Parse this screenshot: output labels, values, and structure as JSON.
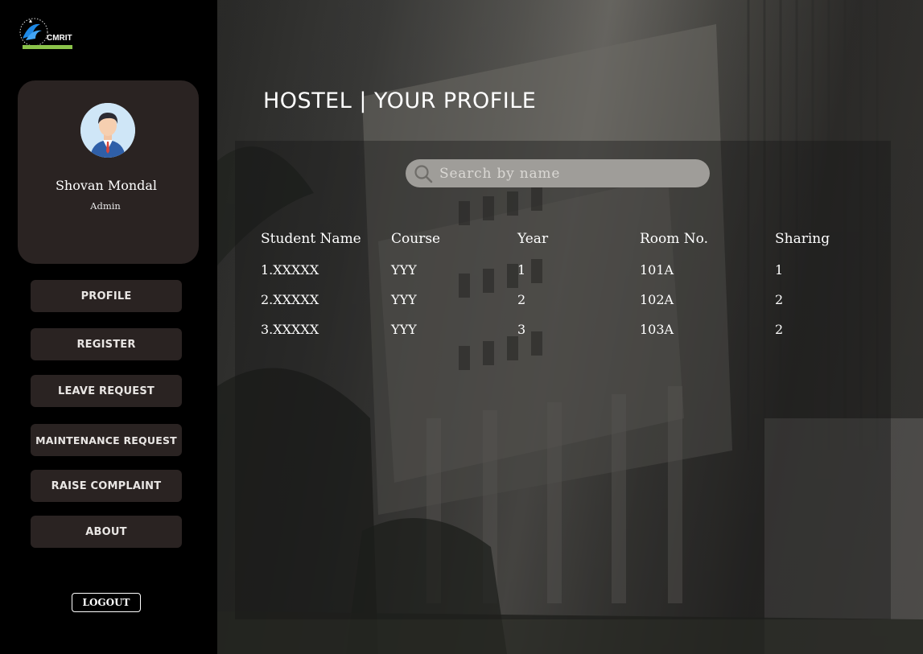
{
  "logo": {
    "text": "CMRIT"
  },
  "profile": {
    "name": "Shovan Mondal",
    "role": "Admin"
  },
  "nav": [
    {
      "label": "PROFILE"
    },
    {
      "label": "REGISTER"
    },
    {
      "label": "LEAVE REQUEST"
    },
    {
      "label": "MAINTENANCE REQUEST"
    },
    {
      "label": "RAISE COMPLAINT"
    },
    {
      "label": "ABOUT"
    }
  ],
  "logout_label": "LOGOUT",
  "page_title": "HOSTEL | YOUR PROFILE",
  "search": {
    "placeholder": "Search by name",
    "value": ""
  },
  "table": {
    "headers": [
      "Student Name",
      "Course",
      "Year",
      "Room No.",
      "Sharing"
    ],
    "rows": [
      [
        "1.XXXXX",
        "YYY",
        "1",
        "101A",
        "1"
      ],
      [
        "2.XXXXX",
        "YYY",
        "2",
        "102A",
        "2"
      ],
      [
        "3.XXXXX",
        "YYY",
        "3",
        "103A",
        "2"
      ]
    ]
  },
  "colors": {
    "sidebar_bg": "#000000",
    "card_bg": "#2a2322",
    "accent_green": "#8bc34a",
    "logo_blue": "#1e88e5"
  }
}
